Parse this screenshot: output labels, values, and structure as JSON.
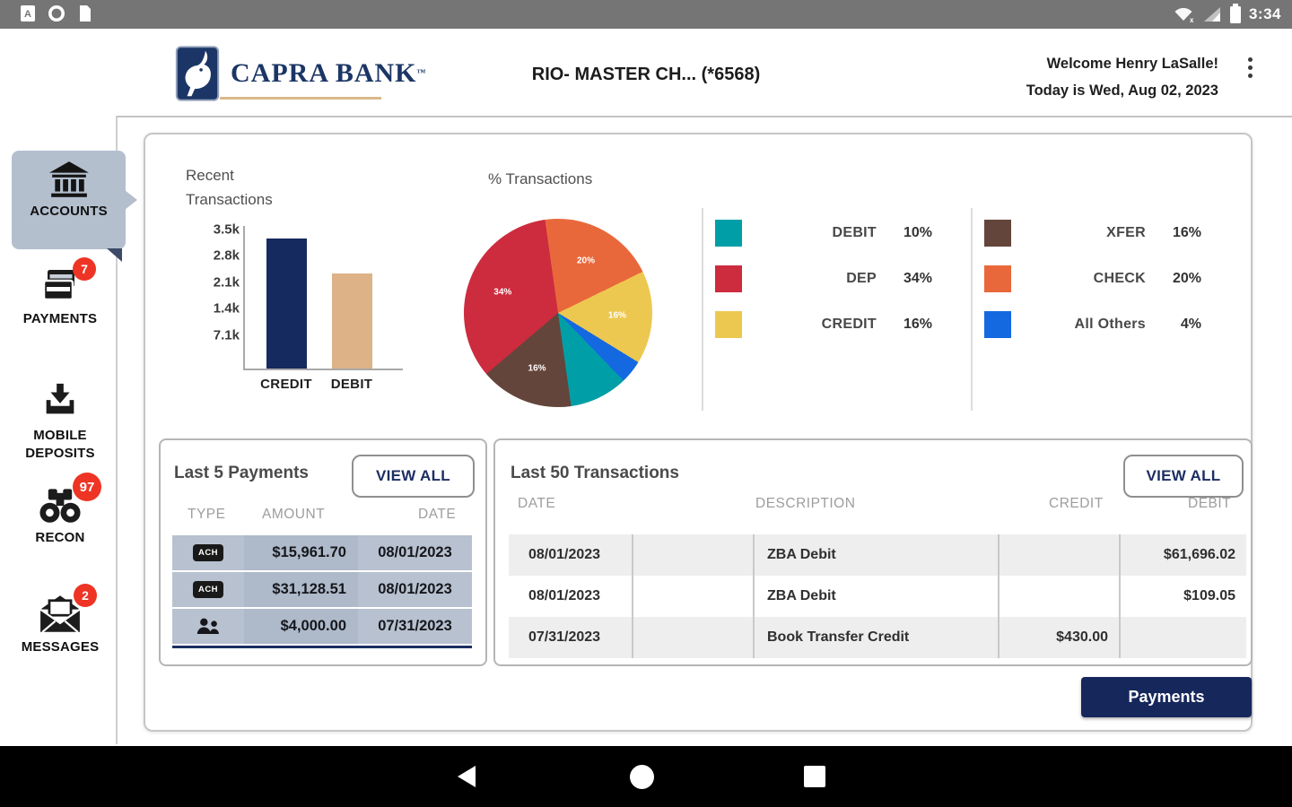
{
  "status_bar": {
    "time": "3:34",
    "notification_icons": [
      "app-letter-icon",
      "circle-app-icon",
      "file-app-icon"
    ],
    "status_icons": [
      "wifi-off-icon",
      "cell-signal-icon",
      "battery-icon"
    ]
  },
  "header": {
    "brand": "CAPRA BANK",
    "brand_tm": "™",
    "account_title": "RIO- MASTER CH...  (*6568)",
    "welcome_line1": "Welcome Henry LaSalle!",
    "welcome_line2": "Today is Wed, Aug 02, 2023"
  },
  "sidebar": {
    "items": [
      {
        "id": "accounts",
        "label": "ACCOUNTS",
        "active": true
      },
      {
        "id": "payments",
        "label": "PAYMENTS",
        "badge": "7"
      },
      {
        "id": "mobile-deposits",
        "label_lines": [
          "MOBILE",
          "DEPOSITS"
        ]
      },
      {
        "id": "recon",
        "label": "RECON",
        "badge": "97"
      },
      {
        "id": "messages",
        "label": "MESSAGES",
        "badge": "2"
      }
    ]
  },
  "chart_data": [
    {
      "type": "bar",
      "title": "Recent Transactions",
      "categories": [
        "CREDIT",
        "DEBIT"
      ],
      "values": [
        3.3,
        2.4
      ],
      "unit": "k",
      "bar_colors": [
        "#152a5e",
        "#ddb287"
      ],
      "y_ticks": [
        "3.5k",
        "2.8k",
        "2.1k",
        "1.4k",
        "7.1k"
      ],
      "ylim": [
        0,
        3.5
      ],
      "grid": false
    },
    {
      "type": "pie",
      "title": "% Transactions",
      "start_angle": -8,
      "slices": [
        {
          "label": "CHECK",
          "value": 20,
          "color": "#e8683c",
          "label_visible": true
        },
        {
          "label": "CREDIT",
          "value": 16,
          "color": "#edc851",
          "label_visible": true
        },
        {
          "label": "All Others",
          "value": 4,
          "color": "#1569e0",
          "label_visible": false
        },
        {
          "label": "DEBIT",
          "value": 10,
          "color": "#009fa7",
          "label_visible": false
        },
        {
          "label": "XFER",
          "value": 16,
          "color": "#64453b",
          "label_visible": true
        },
        {
          "label": "DEP",
          "value": 34,
          "color": "#cd2b3e",
          "label_visible": true
        }
      ],
      "legend_position": "right"
    }
  ],
  "legend": {
    "col1": [
      {
        "label": "DEBIT",
        "value": "10%",
        "color": "#009fa7"
      },
      {
        "label": "DEP",
        "value": "34%",
        "color": "#cd2b3e"
      },
      {
        "label": "CREDIT",
        "value": "16%",
        "color": "#edc851"
      }
    ],
    "col2": [
      {
        "label": "XFER",
        "value": "16%",
        "color": "#64453b"
      },
      {
        "label": "CHECK",
        "value": "20%",
        "color": "#e8683c"
      },
      {
        "label": "All Others",
        "value": "4%",
        "color": "#1569e0"
      }
    ]
  },
  "payments_panel": {
    "title": "Last 5 Payments",
    "view_all_label": "VIEW ALL",
    "headers": [
      "TYPE",
      "AMOUNT",
      "DATE"
    ],
    "rows": [
      {
        "type": "ACH",
        "type_icon": "ach-badge",
        "amount": "$15,961.70",
        "date": "08/01/2023"
      },
      {
        "type": "ACH",
        "type_icon": "ach-badge",
        "amount": "$31,128.51",
        "date": "08/01/2023"
      },
      {
        "type": "PERSON",
        "type_icon": "people-icon",
        "amount": "$4,000.00",
        "date": "07/31/2023"
      }
    ]
  },
  "transactions_panel": {
    "title": "Last 50 Transactions",
    "view_all_label": "VIEW ALL",
    "headers": [
      "DATE",
      "DESCRIPTION",
      "CREDIT",
      "DEBIT"
    ],
    "rows": [
      {
        "date": "08/01/2023",
        "description": "ZBA Debit",
        "credit": "",
        "debit": "$61,696.02"
      },
      {
        "date": "08/01/2023",
        "description": "ZBA Debit",
        "credit": "",
        "debit": "$109.05"
      },
      {
        "date": "07/31/2023",
        "description": "Book Transfer Credit",
        "credit": "$430.00",
        "debit": ""
      }
    ]
  },
  "footer": {
    "payments_button_label": "Payments"
  },
  "colors": {
    "navy": "#16275c",
    "active_tile": "#b4bfce",
    "badge_red": "#ee3424",
    "bar_credit": "#152a5e",
    "bar_debit": "#ddb287"
  }
}
